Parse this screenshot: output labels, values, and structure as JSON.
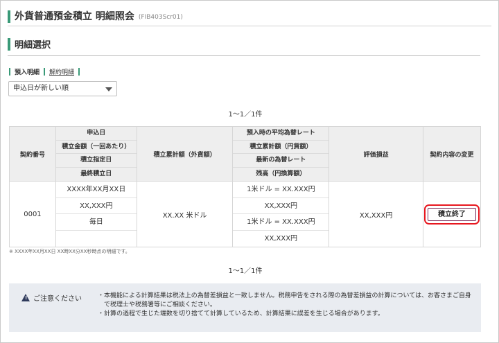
{
  "header": {
    "title": "外貨普通預金積立 明細照会",
    "screen_id": "(FIB403Scr01)"
  },
  "section": {
    "title": "明細選択"
  },
  "tabs": [
    {
      "label": "預入明細",
      "active": true
    },
    {
      "label": "解約明細",
      "active": false
    }
  ],
  "sort": {
    "selected": "申込日が新しい順"
  },
  "pager": {
    "top": "1～1／1件",
    "bottom": "1～1／1件"
  },
  "table": {
    "headers": {
      "contract_no": "契約番号",
      "col2": [
        "申込日",
        "積立金額（一回あたり）",
        "積立指定日",
        "最終積立日"
      ],
      "accumulated_fx": "積立累計額（外貨額）",
      "col4": [
        "預入時の平均為替レート",
        "積立累計額（円貨額）",
        "最新の為替レート",
        "残高（円換算額）"
      ],
      "valuation": "評価損益",
      "change": "契約内容の変更"
    },
    "rows": [
      {
        "contract_no": "0001",
        "col2": [
          "XXXX年XX月XX日",
          "XX,XXX円",
          "毎日",
          ""
        ],
        "accumulated_fx": "XX.XX 米ドル",
        "col4": [
          "1米ドル = XX.XXX円",
          "XX,XXX円",
          "1米ドル = XX.XXX円",
          "XX,XXX円"
        ],
        "valuation": "XX,XXX円",
        "action_label": "積立終了"
      }
    ]
  },
  "note": "※ XXXX年XX月XX日 XX時XX分XX秒時点の明細です。",
  "caution": {
    "heading": "ご注意ください",
    "items": [
      "・本機能による計算結果は税法上の為替差損益と一致しません。税務申告をされる際の為替差損益の計算については、お客さまご自身で税理士や税務署等にご相談ください。",
      "・計算の過程で生じた端数を切り捨てて計算しているため、計算結果に誤差を生じる場合があります。"
    ]
  },
  "colors": {
    "accent": "#3a9a78",
    "highlight": "#e8171f",
    "caution_bg": "#e9ecf1"
  }
}
